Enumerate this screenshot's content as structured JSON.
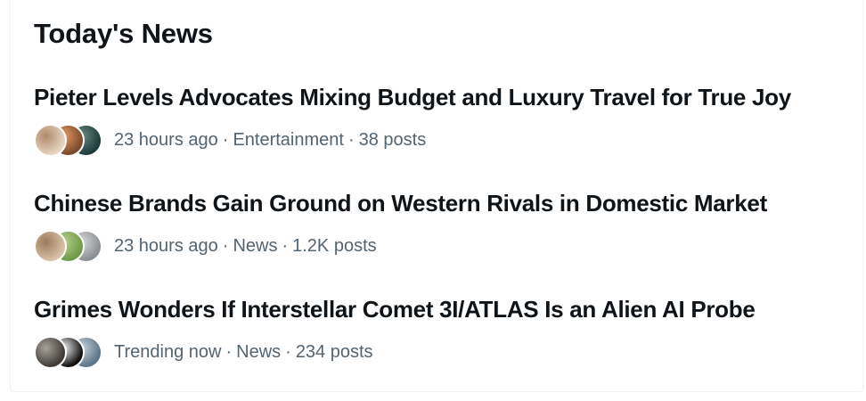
{
  "module": {
    "title": "Today's News"
  },
  "news": [
    {
      "headline": "Pieter Levels Advocates Mixing Budget and Luxury Travel for True Joy",
      "time": "23 hours ago",
      "category": "Entertainment",
      "posts": "38 posts",
      "avatar_colors": [
        [
          "#e6d4bf",
          "#b08a6c"
        ],
        [
          "#7a4a2c",
          "#e59a64"
        ],
        [
          "#1d3b3a",
          "#6a8a84"
        ]
      ]
    },
    {
      "headline": "Chinese Brands Gain Ground on Western Rivals in Domestic Market",
      "time": "23 hours ago",
      "category": "News",
      "posts": "1.2K posts",
      "avatar_colors": [
        [
          "#d8c2a8",
          "#9c7a5a"
        ],
        [
          "#6f9a4a",
          "#b6d08a"
        ],
        [
          "#8a8f93",
          "#d7d9db"
        ]
      ]
    },
    {
      "headline": "Grimes Wonders If Interstellar Comet 3I/ATLAS Is an Alien AI Probe",
      "time": "Trending now",
      "category": "News",
      "posts": "234 posts",
      "avatar_colors": [
        [
          "#3d3a36",
          "#a9a29a"
        ],
        [
          "#0f0f0f",
          "#f2f2f2"
        ],
        [
          "#5b7488",
          "#c7d3dc"
        ]
      ]
    }
  ],
  "separator": "·"
}
